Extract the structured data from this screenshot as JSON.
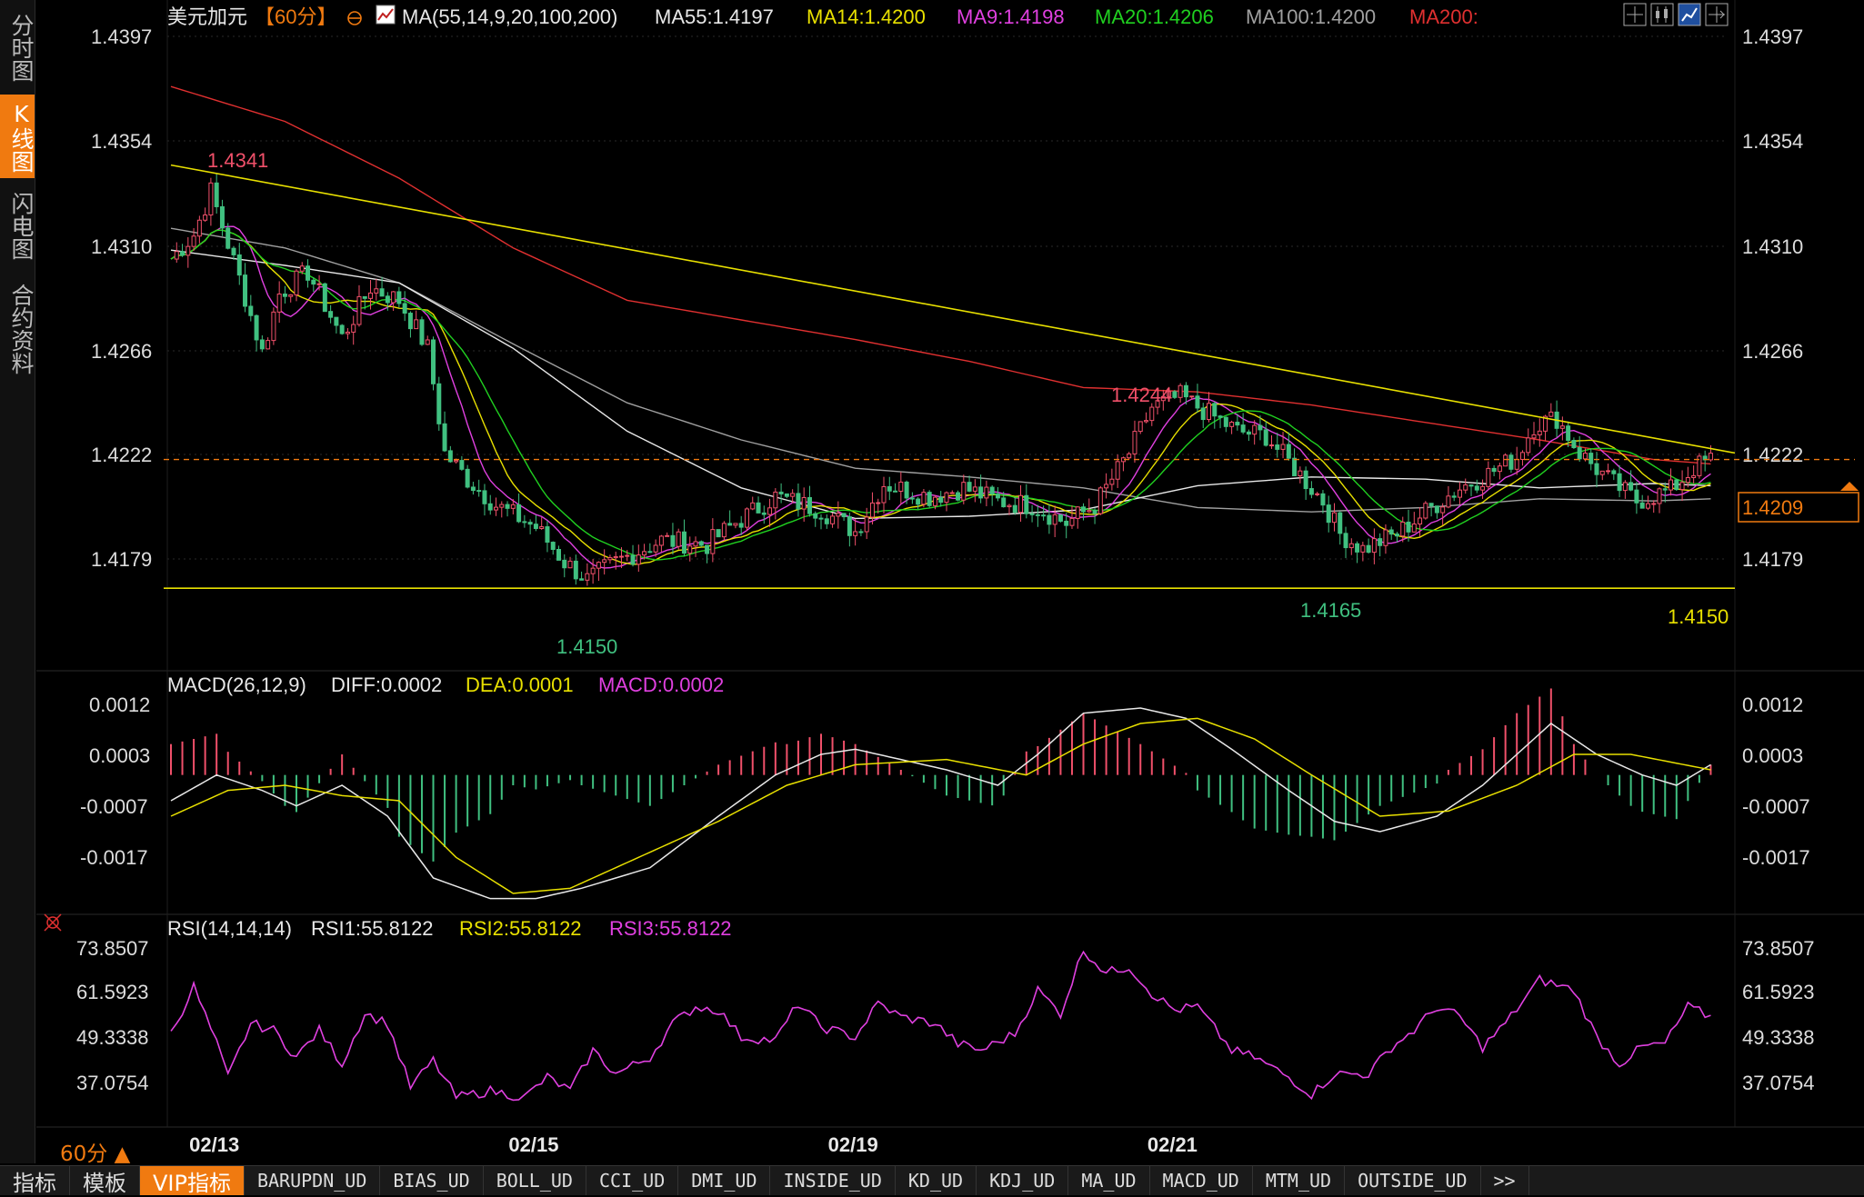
{
  "left_tabs": [
    "分时图",
    "K线图",
    "闪电图",
    "合约资料"
  ],
  "left_active": 1,
  "header": {
    "title": "美元加元",
    "period": "【60分】",
    "ma_params": "MA(55,14,9,20,100,200)",
    "ma_values": [
      {
        "text": "MA55:1.4197",
        "color": "#e8e8e8"
      },
      {
        "text": "MA14:1.4200",
        "color": "#e8e000"
      },
      {
        "text": "MA9:1.4198",
        "color": "#e040e0"
      },
      {
        "text": "MA20:1.4206",
        "color": "#20d020"
      },
      {
        "text": "MA100:1.4200",
        "color": "#a0a0a0"
      },
      {
        "text": "MA200:",
        "color": "#e03030"
      }
    ]
  },
  "annotations": {
    "high1": "1.4341",
    "high2": "1.4244",
    "low1": "1.4150",
    "low2": "1.4165",
    "support": "1.4150",
    "current": "1.4209"
  },
  "macd_header": {
    "params": "MACD(26,12,9)",
    "diff": "DIFF:0.0002",
    "dea": "DEA:0.0001",
    "macd": "MACD:0.0002"
  },
  "rsi_header": {
    "params": "RSI(14,14,14)",
    "rsi1": "RSI1:55.8122",
    "rsi2": "RSI2:55.8122",
    "rsi3": "RSI3:55.8122"
  },
  "timeframe_button": "60分 ▲",
  "bottom_tabs": [
    "指标",
    "模板",
    "VIP指标",
    "BARUPDN_UD",
    "BIAS_UD",
    "BOLL_UD",
    "CCI_UD",
    "DMI_UD",
    "INSIDE_UD",
    "KD_UD",
    "KDJ_UD",
    "MA_UD",
    "MACD_UD",
    "MTM_UD",
    "OUTSIDE_UD",
    ">>"
  ],
  "bottom_active": 2,
  "colors": {
    "up": "#f0506a",
    "down": "#40c080",
    "ma55": "#e8e8e8",
    "ma14": "#e8e000",
    "ma9": "#e040e0",
    "ma20": "#20d020",
    "ma100": "#a0a0a0",
    "ma200": "#e03030",
    "trendline": "#e8e000",
    "accent": "#f07a10"
  },
  "chart_data": [
    {
      "type": "candlestick",
      "title": "美元加元【60分】",
      "y_ticks": [
        "1.4397",
        "1.4354",
        "1.4310",
        "1.4266",
        "1.4222",
        "1.4179"
      ],
      "ylim": [
        1.4128,
        1.4408
      ],
      "x_tick_labels": [
        {
          "label": "02/13",
          "bar": 8
        },
        {
          "label": "02/15",
          "bar": 64
        },
        {
          "label": "02/19",
          "bar": 120
        },
        {
          "label": "02/21",
          "bar": 176
        }
      ],
      "bar_count": 226,
      "anchors": [
        [
          0,
          1.4301
        ],
        [
          4,
          1.4312
        ],
        [
          7,
          1.4332
        ],
        [
          12,
          1.4292
        ],
        [
          16,
          1.4258
        ],
        [
          19,
          1.4285
        ],
        [
          24,
          1.4295
        ],
        [
          30,
          1.4265
        ],
        [
          35,
          1.4288
        ],
        [
          40,
          1.4282
        ],
        [
          45,
          1.426
        ],
        [
          48,
          1.4212
        ],
        [
          52,
          1.42
        ],
        [
          57,
          1.4188
        ],
        [
          64,
          1.4178
        ],
        [
          69,
          1.4162
        ],
        [
          73,
          1.4154
        ],
        [
          78,
          1.4162
        ],
        [
          86,
          1.4172
        ],
        [
          94,
          1.417
        ],
        [
          99,
          1.418
        ],
        [
          106,
          1.4192
        ],
        [
          114,
          1.4186
        ],
        [
          120,
          1.4176
        ],
        [
          125,
          1.4198
        ],
        [
          133,
          1.4192
        ],
        [
          139,
          1.4196
        ],
        [
          145,
          1.419
        ],
        [
          151,
          1.4188
        ],
        [
          157,
          1.418
        ],
        [
          162,
          1.4188
        ],
        [
          168,
          1.4212
        ],
        [
          172,
          1.4233
        ],
        [
          177,
          1.4238
        ],
        [
          182,
          1.423
        ],
        [
          187,
          1.4222
        ],
        [
          192,
          1.422
        ],
        [
          197,
          1.4205
        ],
        [
          202,
          1.419
        ],
        [
          205,
          1.4175
        ],
        [
          209,
          1.4168
        ],
        [
          215,
          1.4175
        ],
        [
          221,
          1.4187
        ],
        [
          226,
          1.4196
        ],
        [
          230,
          1.4201
        ],
        [
          236,
          1.421
        ],
        [
          239,
          1.4225
        ],
        [
          243,
          1.4228
        ],
        [
          247,
          1.4212
        ],
        [
          252,
          1.42
        ],
        [
          257,
          1.419
        ],
        [
          263,
          1.4195
        ],
        [
          267,
          1.4205
        ],
        [
          270,
          1.4209
        ]
      ],
      "moving_averages": [
        {
          "name": "MA200",
          "color": "#e03030",
          "points": [
            [
              0,
              1.438
            ],
            [
              20,
              1.4364
            ],
            [
              40,
              1.4338
            ],
            [
              60,
              1.4306
            ],
            [
              80,
              1.4282
            ],
            [
              100,
              1.4273
            ],
            [
              120,
              1.4264
            ],
            [
              140,
              1.4254
            ],
            [
              160,
              1.4242
            ],
            [
              180,
              1.424
            ],
            [
              200,
              1.4234
            ],
            [
              220,
              1.4226
            ],
            [
              240,
              1.4218
            ],
            [
              260,
              1.4209
            ],
            [
              270,
              1.4207
            ]
          ]
        },
        {
          "name": "MA100",
          "color": "#a0a0a0",
          "points": [
            [
              0,
              1.4315
            ],
            [
              20,
              1.4306
            ],
            [
              40,
              1.429
            ],
            [
              60,
              1.4262
            ],
            [
              80,
              1.4235
            ],
            [
              100,
              1.4218
            ],
            [
              120,
              1.4205
            ],
            [
              140,
              1.4201
            ],
            [
              160,
              1.4196
            ],
            [
              180,
              1.4187
            ],
            [
              200,
              1.4185
            ],
            [
              220,
              1.4187
            ],
            [
              240,
              1.4191
            ],
            [
              260,
              1.419
            ],
            [
              270,
              1.4191
            ]
          ]
        },
        {
          "name": "MA55",
          "color": "#e8e8e8",
          "points": [
            [
              0,
              1.4305
            ],
            [
              20,
              1.4298
            ],
            [
              40,
              1.429
            ],
            [
              60,
              1.426
            ],
            [
              80,
              1.4222
            ],
            [
              100,
              1.4196
            ],
            [
              120,
              1.4182
            ],
            [
              140,
              1.4183
            ],
            [
              160,
              1.4186
            ],
            [
              180,
              1.4197
            ],
            [
              200,
              1.4201
            ],
            [
              220,
              1.42
            ],
            [
              240,
              1.4196
            ],
            [
              260,
              1.4198
            ],
            [
              270,
              1.4197
            ]
          ]
        }
      ],
      "trendline": [
        [
          0,
          1.4344
        ],
        [
          270,
          1.4217
        ]
      ],
      "support_line": 1.415,
      "current_price": 1.4209
    },
    {
      "type": "bar+line",
      "title": "MACD(26,12,9)",
      "y_ticks": [
        "0.0012",
        "0.0003",
        "-0.0007",
        "-0.0017"
      ],
      "ylim": [
        -0.0026,
        0.0016
      ],
      "diff_anchors": [
        [
          0,
          -0.0005
        ],
        [
          8,
          0.0
        ],
        [
          16,
          -0.0003
        ],
        [
          22,
          -0.0006
        ],
        [
          30,
          -0.0002
        ],
        [
          38,
          -0.0008
        ],
        [
          46,
          -0.002
        ],
        [
          56,
          -0.0024
        ],
        [
          64,
          -0.0024
        ],
        [
          72,
          -0.0022
        ],
        [
          84,
          -0.0018
        ],
        [
          96,
          -0.0008
        ],
        [
          106,
          0.0
        ],
        [
          114,
          0.0004
        ],
        [
          120,
          0.0005
        ],
        [
          128,
          0.0003
        ],
        [
          136,
          0.0001
        ],
        [
          145,
          -0.0002
        ],
        [
          152,
          0.0004
        ],
        [
          160,
          0.0012
        ],
        [
          170,
          0.0013
        ],
        [
          178,
          0.0011
        ],
        [
          186,
          0.0005
        ],
        [
          196,
          -0.0003
        ],
        [
          204,
          -0.0009
        ],
        [
          212,
          -0.0011
        ],
        [
          222,
          -0.0008
        ],
        [
          230,
          -0.0002
        ],
        [
          236,
          0.0004
        ],
        [
          242,
          0.001
        ],
        [
          250,
          0.0004
        ],
        [
          258,
          0.0
        ],
        [
          264,
          -0.0002
        ],
        [
          270,
          0.0002
        ]
      ],
      "dea_anchors": [
        [
          0,
          -0.0008
        ],
        [
          10,
          -0.0003
        ],
        [
          20,
          -0.0002
        ],
        [
          30,
          -0.0004
        ],
        [
          40,
          -0.0005
        ],
        [
          50,
          -0.0016
        ],
        [
          60,
          -0.0023
        ],
        [
          70,
          -0.0022
        ],
        [
          84,
          -0.0015
        ],
        [
          96,
          -0.0009
        ],
        [
          108,
          -0.0002
        ],
        [
          120,
          0.0002
        ],
        [
          136,
          0.0003
        ],
        [
          150,
          0.0
        ],
        [
          160,
          0.0006
        ],
        [
          170,
          0.001
        ],
        [
          180,
          0.0011
        ],
        [
          190,
          0.0007
        ],
        [
          200,
          0.0
        ],
        [
          212,
          -0.0008
        ],
        [
          224,
          -0.0007
        ],
        [
          236,
          -0.0002
        ],
        [
          246,
          0.0004
        ],
        [
          256,
          0.0004
        ],
        [
          270,
          0.0001
        ]
      ]
    },
    {
      "type": "line",
      "title": "RSI(14,14,14)",
      "y_ticks": [
        "73.8507",
        "61.5923",
        "49.3338",
        "37.0754"
      ],
      "ylim": [
        25,
        78
      ],
      "anchors": [
        [
          0,
          49
        ],
        [
          4,
          63
        ],
        [
          8,
          46
        ],
        [
          10,
          36
        ],
        [
          14,
          52
        ],
        [
          18,
          50
        ],
        [
          22,
          42
        ],
        [
          26,
          50
        ],
        [
          30,
          40
        ],
        [
          34,
          55
        ],
        [
          38,
          52
        ],
        [
          42,
          33
        ],
        [
          46,
          41
        ],
        [
          50,
          30
        ],
        [
          56,
          32
        ],
        [
          62,
          30
        ],
        [
          66,
          36
        ],
        [
          70,
          32
        ],
        [
          74,
          44
        ],
        [
          78,
          37
        ],
        [
          84,
          42
        ],
        [
          88,
          52
        ],
        [
          92,
          57
        ],
        [
          96,
          56
        ],
        [
          100,
          48
        ],
        [
          106,
          47
        ],
        [
          110,
          58
        ],
        [
          114,
          51
        ],
        [
          120,
          48
        ],
        [
          124,
          58
        ],
        [
          128,
          54
        ],
        [
          134,
          52
        ],
        [
          138,
          46
        ],
        [
          142,
          44
        ],
        [
          148,
          49
        ],
        [
          152,
          62
        ],
        [
          156,
          55
        ],
        [
          160,
          74
        ],
        [
          164,
          67
        ],
        [
          168,
          69
        ],
        [
          172,
          61
        ],
        [
          176,
          56
        ],
        [
          180,
          57
        ],
        [
          186,
          44
        ],
        [
          190,
          42
        ],
        [
          196,
          36
        ],
        [
          200,
          31
        ],
        [
          204,
          37
        ],
        [
          210,
          37
        ],
        [
          214,
          45
        ],
        [
          218,
          50
        ],
        [
          222,
          57
        ],
        [
          226,
          54
        ],
        [
          230,
          45
        ],
        [
          234,
          52
        ],
        [
          240,
          65
        ],
        [
          246,
          62
        ],
        [
          250,
          48
        ],
        [
          254,
          40
        ],
        [
          258,
          45
        ],
        [
          262,
          46
        ],
        [
          266,
          57
        ],
        [
          270,
          54
        ]
      ]
    }
  ]
}
